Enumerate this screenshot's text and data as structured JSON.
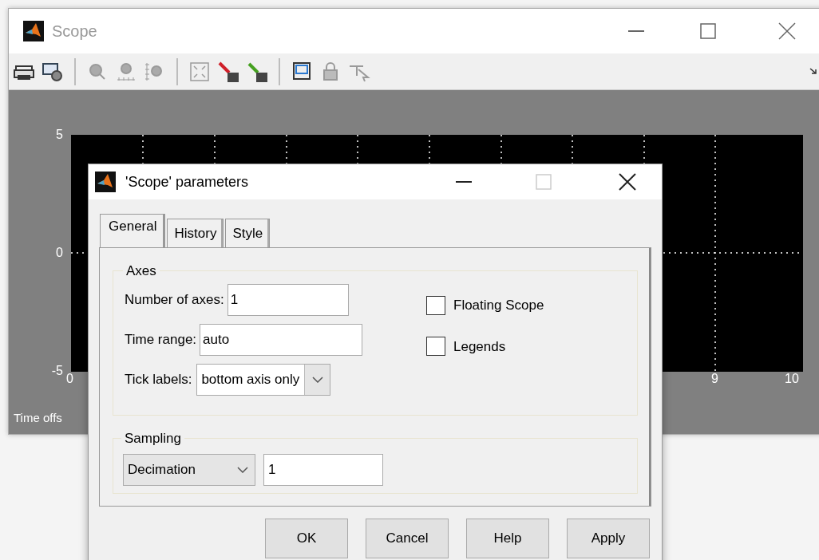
{
  "scope_window": {
    "title": "Scope"
  },
  "plot": {
    "y_ticks": [
      "5",
      "0",
      "-5"
    ],
    "x_ticks": [
      "0",
      "9",
      "10"
    ],
    "footer": "Time offs"
  },
  "dialog": {
    "title": "'Scope' parameters",
    "tabs": [
      {
        "label": "General",
        "selected": true
      },
      {
        "label": "History",
        "selected": false
      },
      {
        "label": "Style",
        "selected": false
      }
    ],
    "axes_group": {
      "title": "Axes",
      "number_of_axes": {
        "label": "Number of axes:",
        "value": "1"
      },
      "time_range": {
        "label": "Time range:",
        "value": "auto"
      },
      "tick_labels": {
        "label": "Tick labels:",
        "value": "bottom axis only"
      },
      "checkboxes": [
        {
          "label": "Floating Scope",
          "checked": false
        },
        {
          "label": "Legends",
          "checked": false
        }
      ]
    },
    "sampling_group": {
      "title": "Sampling",
      "mode": "Decimation",
      "value": "1"
    },
    "buttons": [
      "OK",
      "Cancel",
      "Help",
      "Apply"
    ]
  }
}
